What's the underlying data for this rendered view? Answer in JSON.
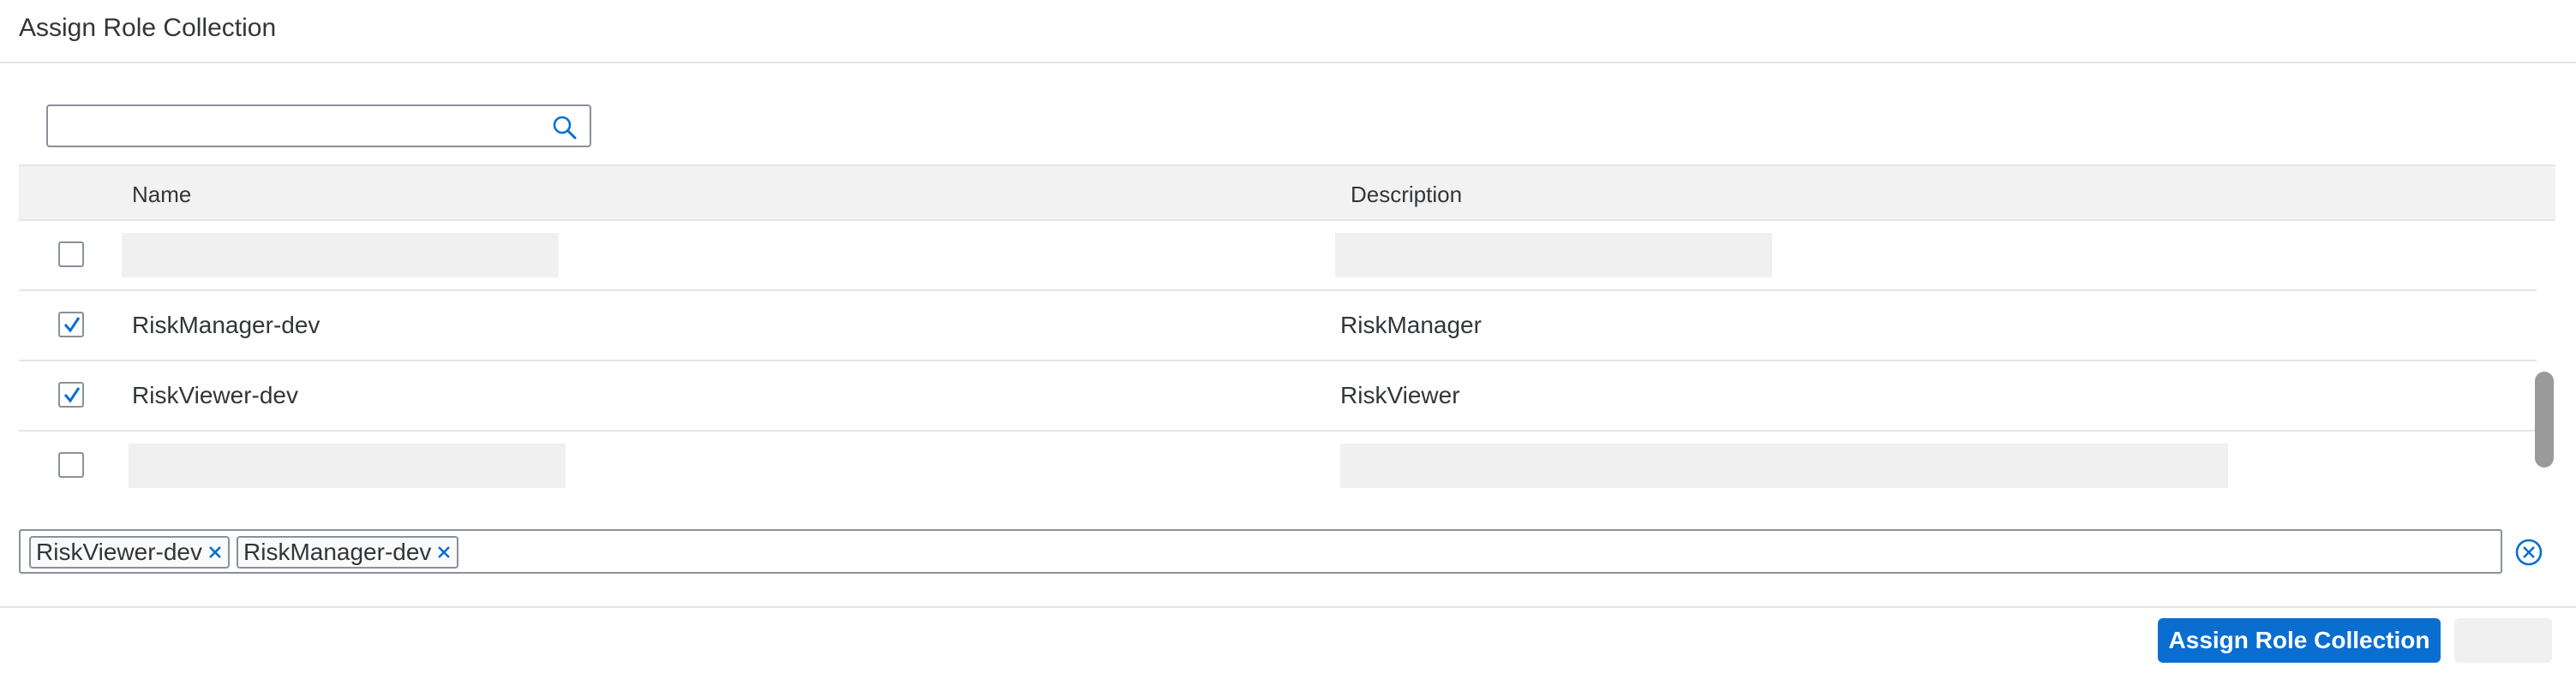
{
  "dialog": {
    "title": "Assign Role Collection"
  },
  "search": {
    "value": "",
    "placeholder": ""
  },
  "table": {
    "columns": [
      "Name",
      "Description"
    ],
    "rows": [
      {
        "checked": false,
        "name": "",
        "description": ""
      },
      {
        "checked": true,
        "name": "RiskManager-dev",
        "description": "RiskManager"
      },
      {
        "checked": true,
        "name": "RiskViewer-dev",
        "description": "RiskViewer"
      },
      {
        "checked": false,
        "name": "",
        "description": ""
      }
    ]
  },
  "tokens": [
    "RiskViewer-dev",
    "RiskManager-dev"
  ],
  "footer": {
    "primary_label": "Assign Role Collection",
    "secondary_label": ""
  },
  "colors": {
    "accent": "#0a6ed1",
    "header_bg": "#f2f2f2",
    "border": "#89919a"
  },
  "icons": {
    "search": "search-icon",
    "checkbox_check": "checkmark-icon",
    "token_remove": "close-icon",
    "clear_all": "clear-all-icon"
  }
}
